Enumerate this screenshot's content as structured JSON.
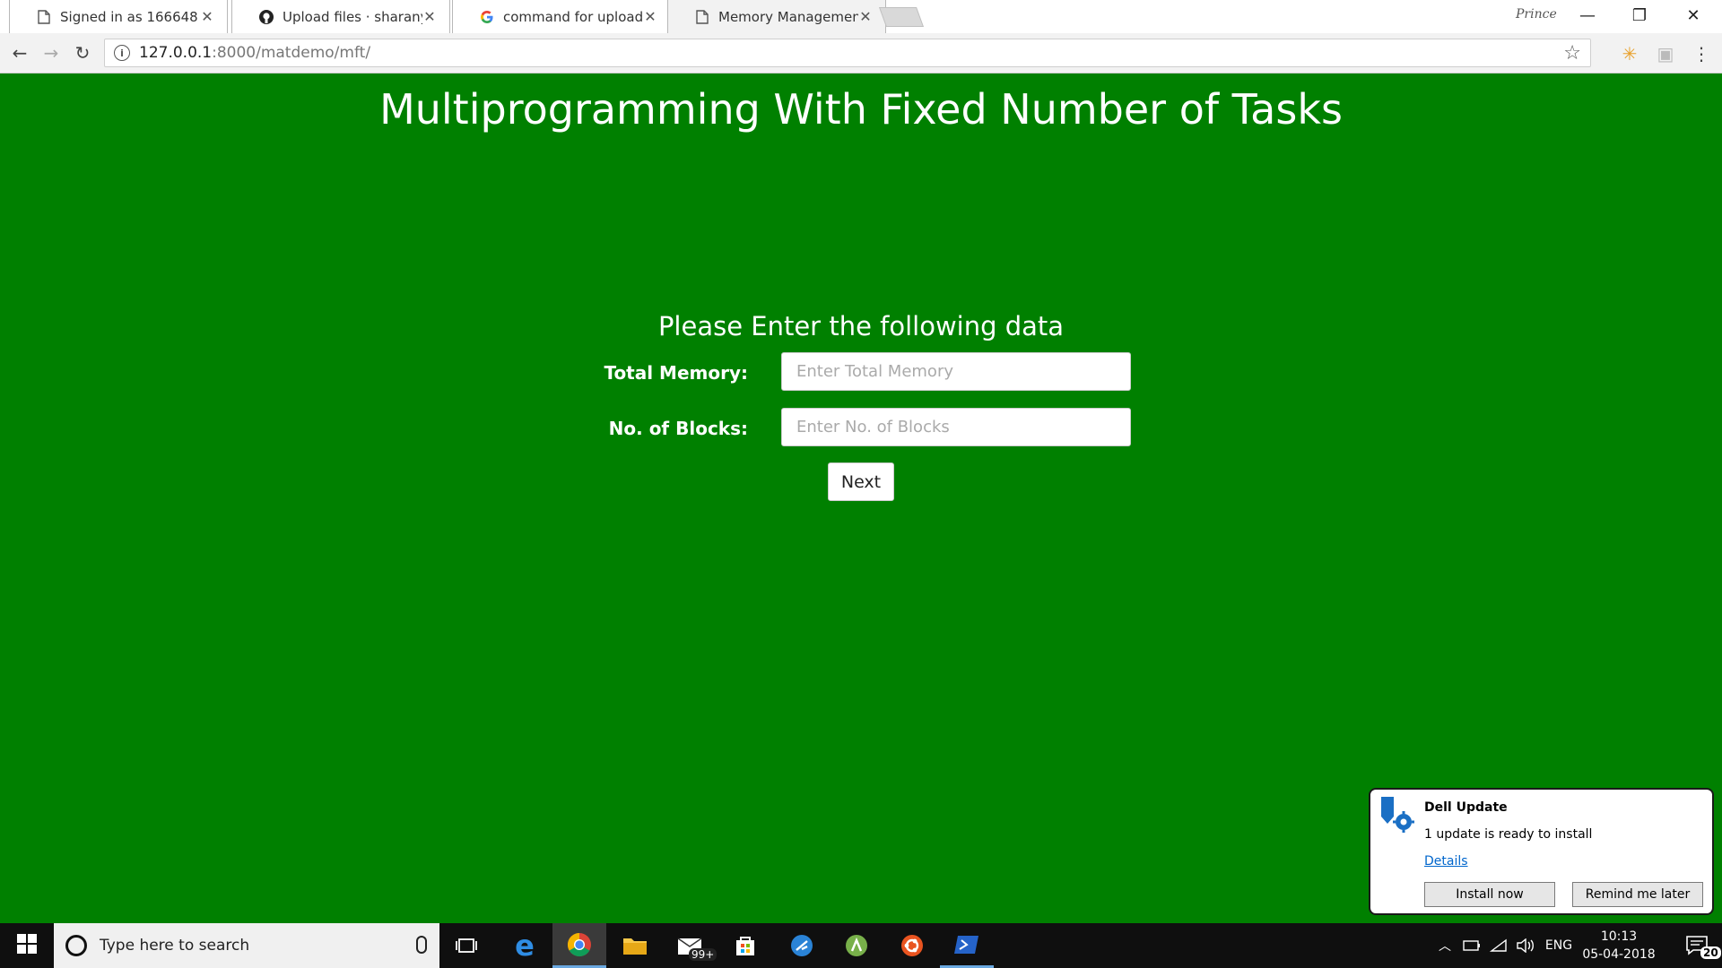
{
  "browser": {
    "tabs": [
      {
        "title": "Signed in as 166648",
        "icon": "page-icon",
        "active": false
      },
      {
        "title": "Upload files · sharanyaka",
        "icon": "github-icon",
        "active": false
      },
      {
        "title": "command for uploading",
        "icon": "google-icon",
        "active": false
      },
      {
        "title": "Memory Management",
        "icon": "page-icon",
        "active": true
      }
    ],
    "profile_name": "Prince",
    "url_host": "127.0.0.1",
    "url_path": ":8000/matdemo/mft/"
  },
  "page": {
    "title": "Multiprogramming With Fixed Number of Tasks",
    "subtitle": "Please Enter the following data",
    "fields": [
      {
        "label": "Total Memory:",
        "placeholder": "Enter Total Memory",
        "value": ""
      },
      {
        "label": "No. of Blocks:",
        "placeholder": "Enter No. of Blocks",
        "value": ""
      }
    ],
    "next_label": "Next",
    "background_color": "#008000"
  },
  "toast": {
    "title": "Dell Update",
    "body": "1 update is ready to install",
    "link": "Details",
    "install_label": "Install now",
    "remind_label": "Remind me later"
  },
  "taskbar": {
    "search_placeholder": "Type here to search",
    "mail_badge": "99+",
    "language": "ENG",
    "time": "10:13",
    "date": "05-04-2018",
    "notification_count": "20"
  }
}
